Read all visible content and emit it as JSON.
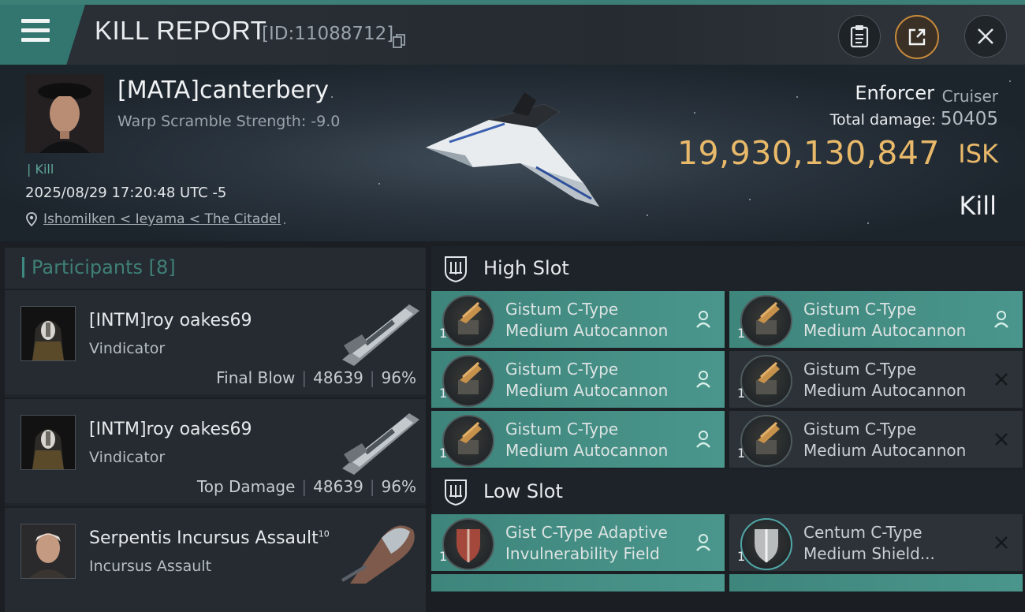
{
  "header": {
    "title": "KILL REPORT",
    "id_text": "[ID:11088712]"
  },
  "victim": {
    "name": "[MATA]canterbery",
    "warp_scramble": "Warp Scramble Strength: -9.0",
    "kill_tag": "| Kill",
    "datetime": "2025/08/29 17:20:48 UTC -5",
    "location": "Ishomilken < Ieyama < The Citadel",
    "ship_name": "Enforcer",
    "ship_class": "Cruiser",
    "total_damage_label": "Total damage:",
    "total_damage": "50405",
    "isk_value": "19,930,130,847",
    "isk_unit": "ISK",
    "result": "Kill"
  },
  "participants": {
    "title": "Participants",
    "count": "[8]",
    "rows": [
      {
        "name": "[INTM]roy oakes69",
        "ship": "Vindicator",
        "role": "Final Blow",
        "damage": "48639",
        "percent": "96%"
      },
      {
        "name": "[INTM]roy oakes69",
        "ship": "Vindicator",
        "role": "Top Damage",
        "damage": "48639",
        "percent": "96%"
      },
      {
        "name": "Serpentis Incursus Assault",
        "sup": "10",
        "ship": "Incursus Assault"
      }
    ]
  },
  "high_slot": {
    "label": "High Slot",
    "modules": [
      {
        "qty": "1",
        "line1": "Gistum C-Type",
        "line2": "Medium Autocannon",
        "status": "person-icon"
      },
      {
        "qty": "1",
        "line1": "Gistum C-Type",
        "line2": "Medium Autocannon",
        "status": "person-icon"
      },
      {
        "qty": "1",
        "line1": "Gistum C-Type",
        "line2": "Medium Autocannon",
        "status": "person-icon"
      },
      {
        "qty": "1",
        "line1": "Gistum C-Type",
        "line2": "Medium Autocannon",
        "status": "x-icon"
      },
      {
        "qty": "1",
        "line1": "Gistum C-Type",
        "line2": "Medium Autocannon",
        "status": "person-icon"
      },
      {
        "qty": "1",
        "line1": "Gistum C-Type",
        "line2": "Medium Autocannon",
        "status": "x-icon"
      }
    ]
  },
  "low_slot": {
    "label": "Low Slot",
    "modules": [
      {
        "qty": "1",
        "line1": "Gist C-Type Adaptive",
        "line2": "Invulnerability Field",
        "status": "person-icon"
      },
      {
        "qty": "1",
        "line1": "Centum C-Type",
        "line2": "Medium Shield...",
        "status": "x-icon"
      }
    ]
  },
  "colors": {
    "accent": "#3f8a80",
    "isk": "#e9b96a",
    "module_online": "#4a968c",
    "module_offline": "#2c3238"
  }
}
